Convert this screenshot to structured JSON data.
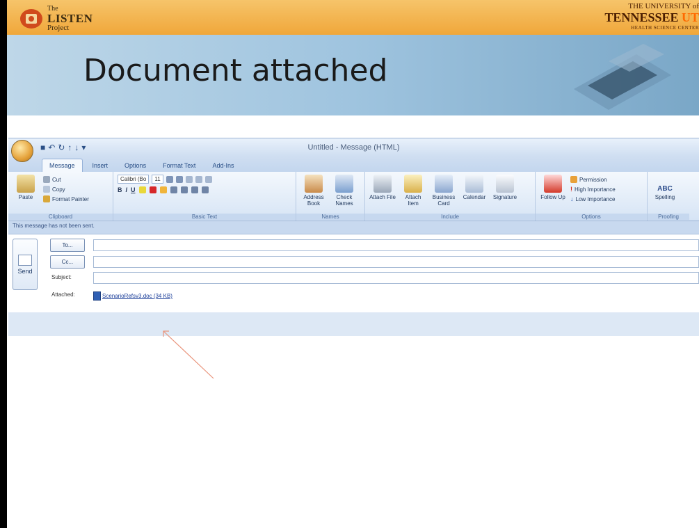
{
  "banner": {
    "listen_the": "The",
    "listen_name": "LISTEN",
    "listen_project": "Project",
    "ut_university": "THE UNIVERSITY of",
    "ut_tennessee": "TENNESSEE",
    "ut_suffix": "UT",
    "ut_hsc": "HEALTH SCIENCE CENTER"
  },
  "slide": {
    "title": "Document attached"
  },
  "outlook": {
    "window_title": "Untitled - Message (HTML)",
    "tabs": [
      "Message",
      "Insert",
      "Options",
      "Format Text",
      "Add-Ins"
    ],
    "ribbon": {
      "clipboard": {
        "paste": "Paste",
        "cut": "Cut",
        "copy": "Copy",
        "format_painter": "Format Painter",
        "label": "Clipboard"
      },
      "basic_text": {
        "font": "Calibri (Bo",
        "size": "11",
        "label": "Basic Text"
      },
      "names": {
        "address_book": "Address Book",
        "check_names": "Check Names",
        "label": "Names"
      },
      "include": {
        "attach_file": "Attach File",
        "attach_item": "Attach Item",
        "business_card": "Business Card",
        "calendar": "Calendar",
        "signature": "Signature",
        "label": "Include"
      },
      "options": {
        "follow_up": "Follow Up",
        "permission": "Permission",
        "high_importance": "High Importance",
        "low_importance": "Low Importance",
        "label": "Options"
      },
      "proofing": {
        "spelling": "Spelling",
        "abc": "ABC",
        "label": "Proofing"
      }
    },
    "info_bar": "This message has not been sent.",
    "send_label": "Send",
    "to_button": "To...",
    "cc_button": "Cc...",
    "subject_label": "Subject:",
    "attached_label": "Attached:",
    "attachment": "ScenarioRefsv3.doc (34 KB)"
  }
}
